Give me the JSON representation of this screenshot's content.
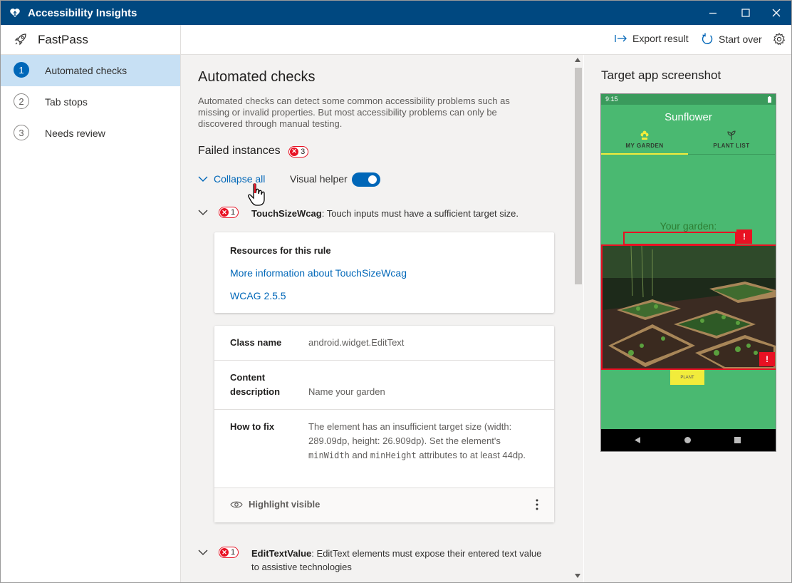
{
  "app": {
    "title": "Accessibility Insights",
    "mode": "FastPass"
  },
  "window_controls": [
    "minimize",
    "maximize",
    "close"
  ],
  "commandbar": {
    "export_label": "Export result",
    "startover_label": "Start over"
  },
  "nav": {
    "items": [
      {
        "number": "1",
        "label": "Automated checks",
        "selected": true
      },
      {
        "number": "2",
        "label": "Tab stops",
        "selected": false
      },
      {
        "number": "3",
        "label": "Needs review",
        "selected": false
      }
    ]
  },
  "main": {
    "heading": "Automated checks",
    "description": "Automated checks can detect some common accessibility problems such as missing or invalid properties. But most accessibility problems can only be discovered through manual testing.",
    "failed_heading": "Failed instances",
    "failed_count": "3",
    "collapse_label": "Collapse all",
    "visual_helper_label": "Visual helper",
    "visual_helper_on": true,
    "rules": [
      {
        "count": "1",
        "name": "TouchSizeWcag",
        "summary": ": Touch inputs must have a sufficient target size."
      },
      {
        "count": "1",
        "name": "EditTextValue",
        "summary": ": EditText elements must expose their entered text value to assistive technologies"
      }
    ],
    "resources": {
      "title": "Resources for this rule",
      "link1": "More information about TouchSizeWcag",
      "link2": "WCAG 2.5.5"
    },
    "details": {
      "class_name_label": "Class name",
      "class_name_value": "android.widget.EditText",
      "content_desc_label": "Content description",
      "content_desc_value": "Name your garden",
      "how_to_fix_label": "How to fix",
      "how_to_fix_part1": "The element has an insufficient target size (width: 289.09dp, height: 26.909dp). Set the element's ",
      "code1": "minWidth",
      "how_to_fix_part2": " and ",
      "code2": "minHeight",
      "how_to_fix_part3": " attributes to at least 44dp.",
      "highlight_label": "Highlight visible"
    }
  },
  "screenshot_panel": {
    "heading": "Target app screenshot",
    "phone": {
      "time": "9:15",
      "title": "Sunflower",
      "tab1": "MY GARDEN",
      "tab2": "PLANT LIST",
      "your_garden": "Your garden:",
      "plant_button": "PLANT",
      "error_mark": "!"
    }
  },
  "colors": {
    "titlebar": "#004880",
    "accent": "#0067b8",
    "error": "#e81123",
    "phone_green": "#4ab971",
    "selected_nav": "#c7e0f4"
  }
}
